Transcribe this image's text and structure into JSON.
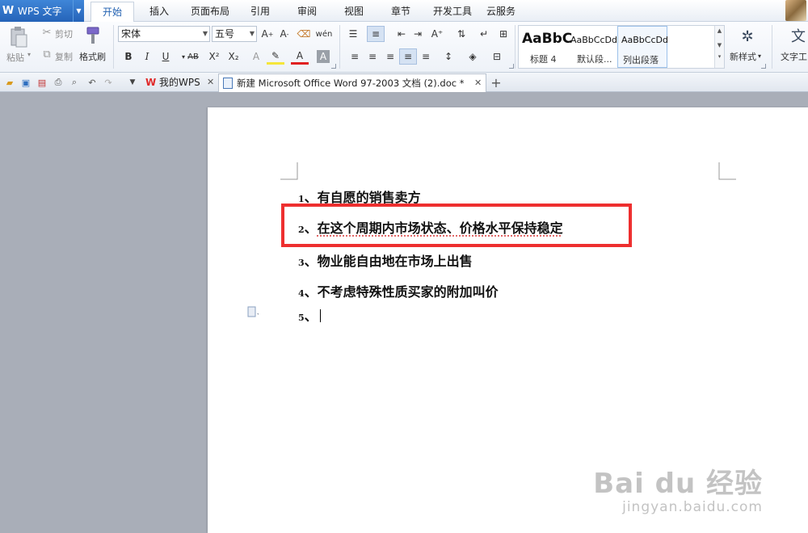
{
  "app": {
    "title": "WPS 文字",
    "logo_letter": "W"
  },
  "menu_tabs": [
    "开始",
    "插入",
    "页面布局",
    "引用",
    "审阅",
    "视图",
    "章节",
    "开发工具",
    "云服务"
  ],
  "ribbon": {
    "paste_label": "粘贴",
    "cut_label": "剪切",
    "copy_label": "复制",
    "format_painter_label": "格式刷",
    "font_name": "宋体",
    "font_size": "五号",
    "bold_glyph": "B",
    "italic_glyph": "I",
    "underline_glyph": "U",
    "strike_glyph": "AB",
    "superscript_glyph": "X²",
    "subscript_glyph": "X₂",
    "styles": [
      {
        "sample": "AaBbC",
        "name": "标题 4"
      },
      {
        "sample": "AaBbCcDd",
        "name": "默认段..."
      },
      {
        "sample": "AaBbCcDd",
        "name": "列出段落"
      }
    ],
    "new_style_label": "新样式",
    "text_tool_label": "文字工"
  },
  "doc_tabs": [
    {
      "label": "我的WPS",
      "icon": "W"
    },
    {
      "label": "新建 Microsoft Office Word 97-2003 文档 (2).doc *",
      "icon": "doc"
    }
  ],
  "document": {
    "lines": [
      {
        "num": "1",
        "sep": "、",
        "text": "有自愿的销售卖方"
      },
      {
        "num": "2",
        "sep": "、",
        "text": "在这个周期内市场状态、价格水平保持稳定"
      },
      {
        "num": "3",
        "sep": "、",
        "text": "物业能自由地在市场上出售"
      },
      {
        "num": "4",
        "sep": "、",
        "text": "不考虑特殊性质买家的附加叫价"
      },
      {
        "num": "5",
        "sep": "、",
        "text": ""
      }
    ]
  },
  "watermark": {
    "brand": "Bai du 经验",
    "url": "jingyan.baidu.com"
  },
  "colors": {
    "accent": "#2563b8",
    "highlight_border": "#ee2f2f",
    "workspace_bg": "#a9aeb8"
  }
}
